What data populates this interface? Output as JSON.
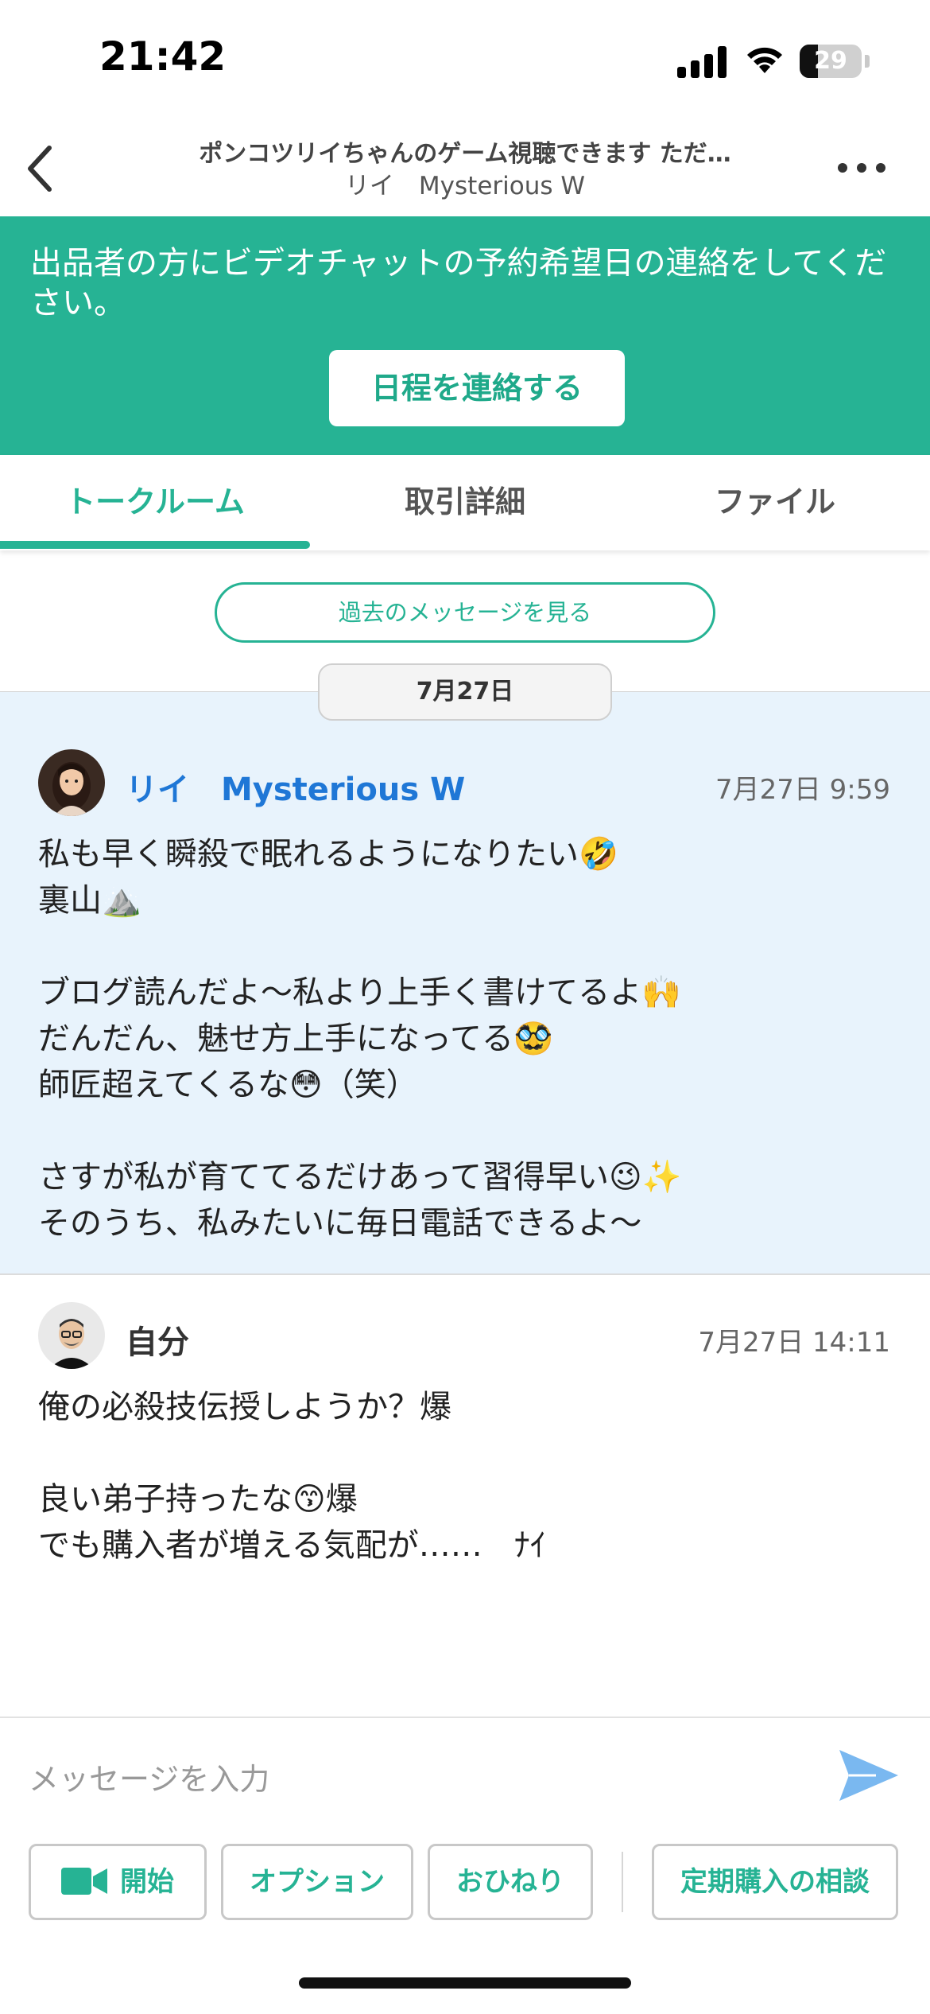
{
  "status_bar": {
    "time": "21:42",
    "battery": "29",
    "battery_level": 0.29
  },
  "header": {
    "title": "ポンコツリイちゃんのゲーム視聴できます ただ…",
    "subtitle": "リイ　Mysterious W"
  },
  "banner": {
    "text": "出品者の方にビデオチャットの予約希望日の連絡をしてください。",
    "button_label": "日程を連絡する"
  },
  "tabs": [
    {
      "label": "トークルーム",
      "active": true
    },
    {
      "label": "取引詳細",
      "active": false
    },
    {
      "label": "ファイル",
      "active": false
    }
  ],
  "past_messages_label": "過去のメッセージを見る",
  "date_separator": "7月27日",
  "messages": [
    {
      "sender": "リイ　Mysterious W",
      "timestamp": "7月27日 9:59",
      "body": "私も早く瞬殺で眠れるようになりたい🤣\n裏山⛰️\n\nブログ読んだよ〜私より上手く書けてるよ🙌\nだんだん、魅せ方上手になってる🥸\n師匠超えてくるな😳（笑）\n\nさすが私が育ててるだけあって習得早い😉✨\nそのうち、私みたいに毎日電話できるよ〜"
    },
    {
      "sender": "自分",
      "timestamp": "7月27日 14:11",
      "body": "俺の必殺技伝授しようか？爆\n\n良い弟子持ったな😙爆\nでも購入者が増える気配が……　ﾅｲ"
    }
  ],
  "composer": {
    "placeholder": "メッセージを入力",
    "actions": {
      "start": "開始",
      "option": "オプション",
      "tip": "おひねり",
      "subscription": "定期購入の相談"
    }
  },
  "colors": {
    "accent": "#26b394",
    "sender_other": "#1f77d6",
    "incoming_bg": "#e8f3fc",
    "send_icon": "#7ab8f0"
  }
}
